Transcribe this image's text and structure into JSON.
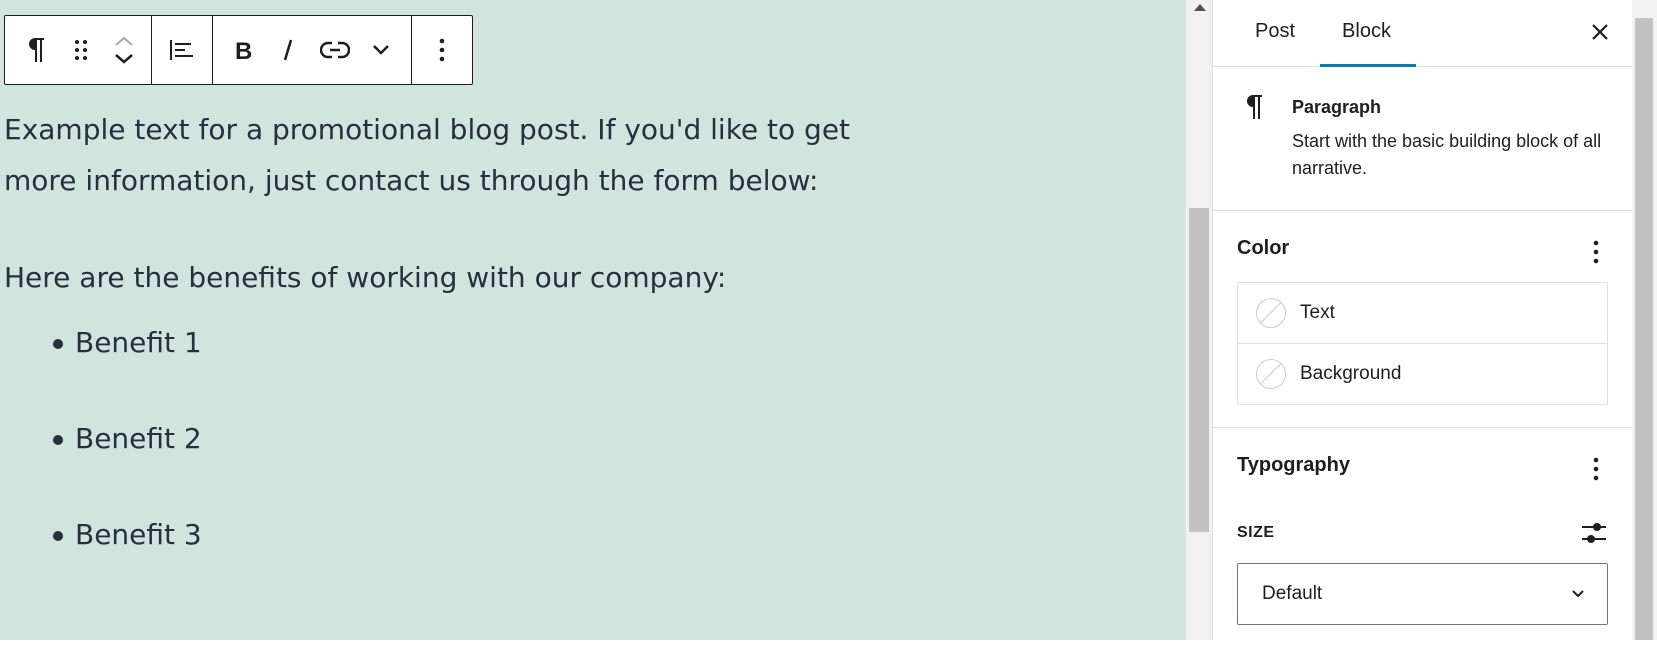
{
  "toolbar": {
    "paragraph_icon": "paragraph-icon",
    "drag_icon": "drag-handle-icon",
    "move_up_icon": "chevron-up-icon",
    "move_down_icon": "chevron-down-icon",
    "align_icon": "align-left-icon",
    "bold_icon": "bold-icon",
    "italic_icon": "italic-icon",
    "link_icon": "link-icon",
    "more_formats_icon": "chevron-down-icon",
    "options_icon": "kebab-icon"
  },
  "content": {
    "paragraph1": "Example text for a promotional blog post. If you'd like to get more information, just contact us through the form below:",
    "paragraph2": "Here are the benefits of working with our company:",
    "list": [
      "Benefit 1",
      "Benefit 2",
      "Benefit 3"
    ]
  },
  "sidebar": {
    "tabs": [
      {
        "label": "Post",
        "active": false
      },
      {
        "label": "Block",
        "active": true
      }
    ],
    "close_icon": "close-icon",
    "block": {
      "title": "Paragraph",
      "description": "Start with the basic building block of all narrative."
    },
    "color": {
      "title": "Color",
      "items": [
        {
          "label": "Text"
        },
        {
          "label": "Background"
        }
      ]
    },
    "typography": {
      "title": "Typography",
      "size_label": "SIZE",
      "size_value": "Default"
    }
  },
  "colors": {
    "editor_bg": "#d1e4dd",
    "text": "#28303d",
    "accent": "#007cba"
  }
}
